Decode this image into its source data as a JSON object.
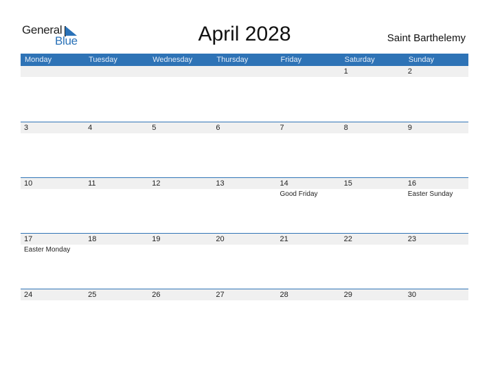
{
  "logo": {
    "word1": "General",
    "word2": "Blue"
  },
  "title": "April 2028",
  "country": "Saint Barthelemy",
  "days": [
    "Monday",
    "Tuesday",
    "Wednesday",
    "Thursday",
    "Friday",
    "Saturday",
    "Sunday"
  ],
  "weeks": [
    [
      {
        "d": ""
      },
      {
        "d": ""
      },
      {
        "d": ""
      },
      {
        "d": ""
      },
      {
        "d": ""
      },
      {
        "d": "1"
      },
      {
        "d": "2"
      }
    ],
    [
      {
        "d": "3"
      },
      {
        "d": "4"
      },
      {
        "d": "5"
      },
      {
        "d": "6"
      },
      {
        "d": "7"
      },
      {
        "d": "8"
      },
      {
        "d": "9"
      }
    ],
    [
      {
        "d": "10"
      },
      {
        "d": "11"
      },
      {
        "d": "12"
      },
      {
        "d": "13"
      },
      {
        "d": "14",
        "e": "Good Friday"
      },
      {
        "d": "15"
      },
      {
        "d": "16",
        "e": "Easter Sunday"
      }
    ],
    [
      {
        "d": "17",
        "e": "Easter Monday"
      },
      {
        "d": "18"
      },
      {
        "d": "19"
      },
      {
        "d": "20"
      },
      {
        "d": "21"
      },
      {
        "d": "22"
      },
      {
        "d": "23"
      }
    ],
    [
      {
        "d": "24"
      },
      {
        "d": "25"
      },
      {
        "d": "26"
      },
      {
        "d": "27"
      },
      {
        "d": "28"
      },
      {
        "d": "29"
      },
      {
        "d": "30"
      }
    ]
  ],
  "colors": {
    "accent": "#2e73b6",
    "band": "#f0f0f0"
  }
}
